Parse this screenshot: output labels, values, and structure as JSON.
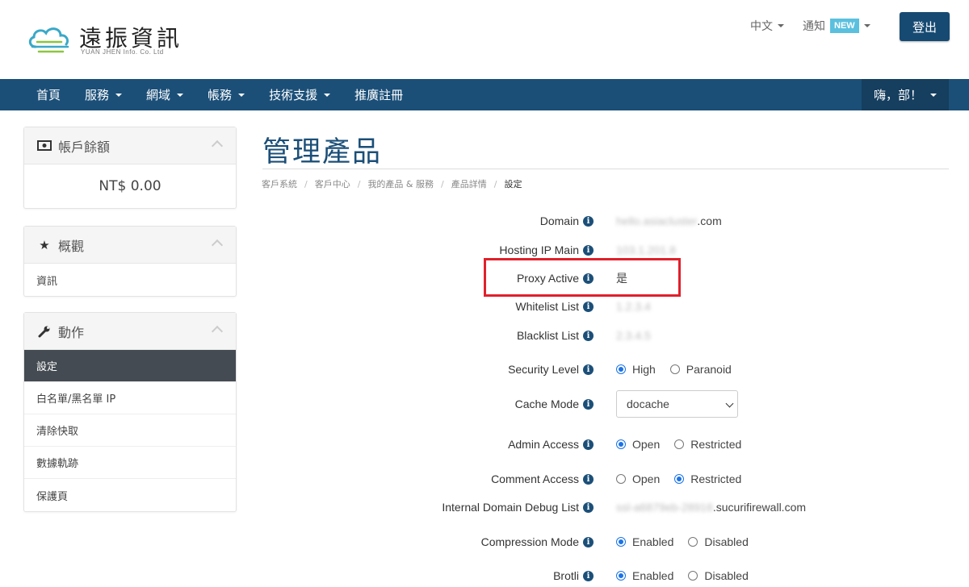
{
  "header": {
    "logo_title": "遠振資訊",
    "logo_subtitle": "YUAN JHEN Info. Co. Ltd",
    "lang_label": "中文",
    "notify_label": "通知",
    "new_badge": "NEW",
    "logout_label": "登出"
  },
  "nav": {
    "items": [
      {
        "label": "首頁"
      },
      {
        "label": "服務"
      },
      {
        "label": "網域"
      },
      {
        "label": "帳務"
      },
      {
        "label": "技術支援"
      },
      {
        "label": "推廣註冊"
      }
    ],
    "user_label": "嗨，部！"
  },
  "sidebar": {
    "balance_title": "帳戶餘額",
    "balance_value": "NT$ 0.00",
    "overview_title": "概觀",
    "overview_items": [
      "資訊"
    ],
    "actions_title": "動作",
    "actions_items": [
      "設定",
      "白名單/黑名單 IP",
      "清除快取",
      "數據軌跡",
      "保護頁"
    ],
    "active_action": "設定"
  },
  "main": {
    "title": "管理產品",
    "breadcrumb": [
      "客戶系統",
      "客戶中心",
      "我的產品 & 服務",
      "產品詳情",
      "設定"
    ],
    "fields": {
      "domain": {
        "label": "Domain",
        "value_hidden": "hello.asiacluster",
        "value_suffix": ".com"
      },
      "hosting_ip": {
        "label": "Hosting IP Main",
        "value_hidden": "103.1.201.8"
      },
      "proxy_active": {
        "label": "Proxy Active",
        "value": "是"
      },
      "whitelist": {
        "label": "Whitelist List",
        "value_hidden": "1.2.3.4"
      },
      "blacklist": {
        "label": "Blacklist List",
        "value_hidden": "2.3.4.5"
      },
      "security_level": {
        "label": "Security Level",
        "options": [
          "High",
          "Paranoid"
        ],
        "selected": "High"
      },
      "cache_mode": {
        "label": "Cache Mode",
        "value": "docache"
      },
      "admin_access": {
        "label": "Admin Access",
        "options": [
          "Open",
          "Restricted"
        ],
        "selected": "Open"
      },
      "comment_access": {
        "label": "Comment Access",
        "options": [
          "Open",
          "Restricted"
        ],
        "selected": "Restricted"
      },
      "internal_debug": {
        "label": "Internal Domain Debug List",
        "value_hidden": "ssl-a6879eb-28916",
        "value_suffix": ".sucurifirewall.com"
      },
      "compression": {
        "label": "Compression Mode",
        "options": [
          "Enabled",
          "Disabled"
        ],
        "selected": "Enabled"
      },
      "brotli": {
        "label": "Brotli",
        "options": [
          "Enabled",
          "Disabled"
        ],
        "selected": "Enabled"
      }
    }
  },
  "colors": {
    "brand": "#1b4f78",
    "highlight": "#e0202b",
    "radio": "#1a73e8"
  }
}
